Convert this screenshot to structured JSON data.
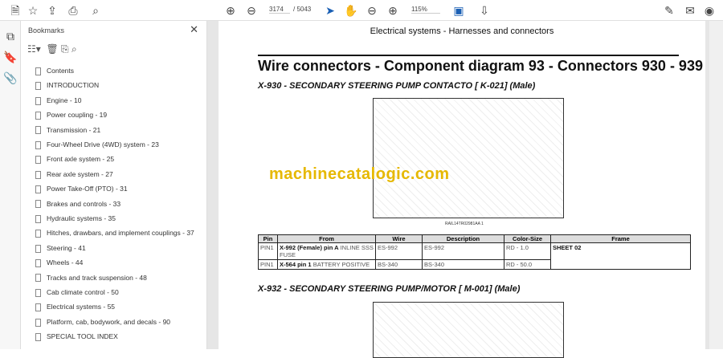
{
  "toolbar": {
    "page_current": "3174",
    "page_total": "/ 5043",
    "zoom": "115%"
  },
  "bookmarks": {
    "title": "Bookmarks",
    "items": [
      "Contents",
      "INTRODUCTION",
      "Engine - 10",
      "Power coupling - 19",
      "Transmission - 21",
      "Four-Wheel Drive (4WD) system - 23",
      "Front axle system - 25",
      "Rear axle system - 27",
      "Power Take-Off (PTO) - 31",
      "Brakes and controls - 33",
      "Hydraulic systems - 35",
      "Hitches, drawbars, and implement couplings - 37",
      "Steering - 41",
      "Wheels - 44",
      "Tracks and track suspension - 48",
      "Cab climate control - 50",
      "Electrical systems - 55",
      "Platform, cab, bodywork, and decals - 90",
      "SPECIAL TOOL INDEX"
    ]
  },
  "doc": {
    "header": "Electrical systems - Harnesses and connectors",
    "title": "Wire connectors - Component diagram 93 - Connectors 930 - 939",
    "section1": "X-930 - SECONDARY STEERING PUMP CONTACTO [ K-021] (Male)",
    "caption": "RAIL14TR02981AA     1",
    "watermark": "machinecatalogic.com",
    "section2": "X-932 - SECONDARY STEERING PUMP/MOTOR [ M-001] (Male)",
    "table": {
      "headers": [
        "Pin",
        "From",
        "Wire",
        "Description",
        "Color-Size",
        "Frame"
      ],
      "rows": [
        {
          "pin": "PIN1",
          "from_b": "X-992 (Female) pin A",
          "from": " INLINE SSS FUSE",
          "wire": "ES-992",
          "desc": "ES-992",
          "color": "RD - 1.0"
        },
        {
          "pin": "PIN1",
          "from_b": "X-564 pin 1",
          "from": " BATTERY POSITIVE",
          "wire": "BS-340",
          "desc": "BS-340",
          "color": "RD - 50.0"
        }
      ],
      "frame": "SHEET 02"
    }
  }
}
